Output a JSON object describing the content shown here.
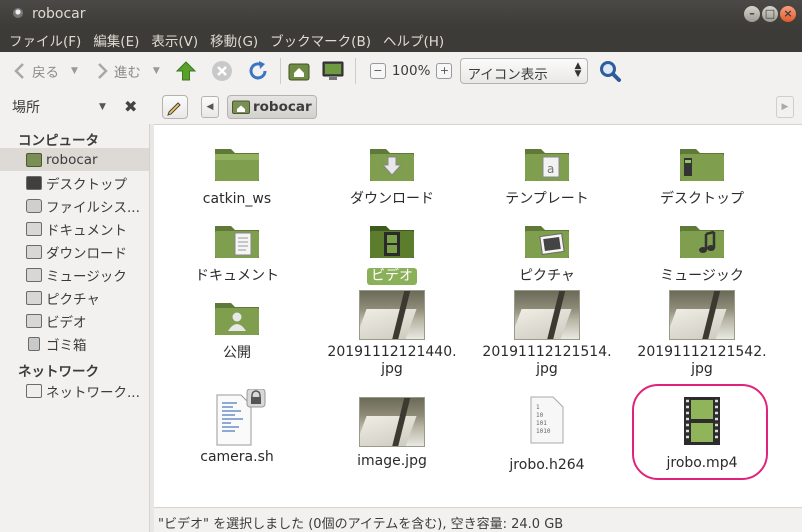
{
  "window": {
    "title": "robocar"
  },
  "menu": [
    "ファイル(F)",
    "編集(E)",
    "表示(V)",
    "移動(G)",
    "ブックマーク(B)",
    "ヘルプ(H)"
  ],
  "toolbar": {
    "back_label": "戻る",
    "forward_label": "進む",
    "zoom_level": "100%",
    "view_mode": "アイコン表示"
  },
  "places": {
    "label": "場所"
  },
  "path": {
    "current": "robocar"
  },
  "sidebar": {
    "sections": [
      {
        "title": "コンピュータ",
        "items": [
          {
            "label": "robocar",
            "icon": "home-folder-icon",
            "active": true
          },
          {
            "label": "デスクトップ",
            "icon": "desktop-icon"
          },
          {
            "label": "ファイルシス...",
            "icon": "drive-icon"
          },
          {
            "label": "ドキュメント",
            "icon": "documents-icon"
          },
          {
            "label": "ダウンロード",
            "icon": "downloads-icon"
          },
          {
            "label": "ミュージック",
            "icon": "music-icon"
          },
          {
            "label": "ピクチャ",
            "icon": "pictures-icon"
          },
          {
            "label": "ビデオ",
            "icon": "videos-icon"
          },
          {
            "label": "ゴミ箱",
            "icon": "trash-icon"
          }
        ]
      },
      {
        "title": "ネットワーク",
        "items": [
          {
            "label": "ネットワーク...",
            "icon": "network-icon"
          }
        ]
      }
    ]
  },
  "files": [
    {
      "name": "catkin_ws",
      "kind": "folder",
      "icon": "folder-icon"
    },
    {
      "name": "ダウンロード",
      "kind": "folder",
      "icon": "downloads-folder-icon"
    },
    {
      "name": "テンプレート",
      "kind": "folder",
      "icon": "templates-folder-icon"
    },
    {
      "name": "デスクトップ",
      "kind": "folder",
      "icon": "desktop-folder-icon"
    },
    {
      "name": "ドキュメント",
      "kind": "folder",
      "icon": "documents-folder-icon"
    },
    {
      "name": "ビデオ",
      "kind": "folder",
      "icon": "videos-folder-icon",
      "selected": true
    },
    {
      "name": "ピクチャ",
      "kind": "folder",
      "icon": "pictures-folder-icon"
    },
    {
      "name": "ミュージック",
      "kind": "folder",
      "icon": "music-folder-icon"
    },
    {
      "name": "公開",
      "kind": "folder",
      "icon": "public-folder-icon"
    },
    {
      "name": "20191112121440.\njpg",
      "kind": "image",
      "icon": "image-thumbnail"
    },
    {
      "name": "20191112121514.\njpg",
      "kind": "image",
      "icon": "image-thumbnail"
    },
    {
      "name": "20191112121542.\njpg",
      "kind": "image",
      "icon": "image-thumbnail"
    },
    {
      "name": "camera.sh",
      "kind": "script",
      "icon": "script-file-icon"
    },
    {
      "name": "image.jpg",
      "kind": "image",
      "icon": "image-thumbnail"
    },
    {
      "name": "jrobo.h264",
      "kind": "binary",
      "icon": "binary-file-icon"
    },
    {
      "name": "jrobo.mp4",
      "kind": "video",
      "icon": "video-file-icon"
    }
  ],
  "status": {
    "text": "\"ビデオ\" を選択しました (0個のアイテムを含む), 空き容量: 24.0 GB"
  },
  "colors": {
    "titlebar": "#3c3b37",
    "folder": "#7a8f55",
    "selection": "#8bb05a",
    "annotation_ring": "#e0227a"
  }
}
